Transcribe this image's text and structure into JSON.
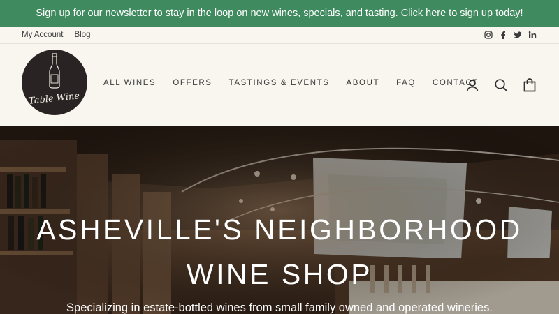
{
  "announcement": {
    "text": "Sign up for our newsletter to stay in the loop on new wines, specials, and tasting. Click here to sign up today!"
  },
  "utility": {
    "links": [
      "My Account",
      "Blog"
    ],
    "social": [
      "instagram-icon",
      "facebook-icon",
      "twitter-icon",
      "linkedin-icon"
    ]
  },
  "logo": {
    "text": "Table Wine"
  },
  "nav": {
    "items": [
      "ALL WINES",
      "OFFERS",
      "TASTINGS & EVENTS",
      "ABOUT",
      "FAQ",
      "CONTACT"
    ]
  },
  "header_icons": [
    "user-icon",
    "search-icon",
    "cart-icon"
  ],
  "hero": {
    "line1": "ASHEVILLE'S NEIGHBORHOOD",
    "line2": "WINE SHOP",
    "subtitle": "Specializing in estate-bottled wines from small family owned and operated wineries."
  },
  "colors": {
    "announcement_bg": "#3f8a5f",
    "page_bg": "#f8f6ef",
    "logo_bg": "#2a2324"
  }
}
